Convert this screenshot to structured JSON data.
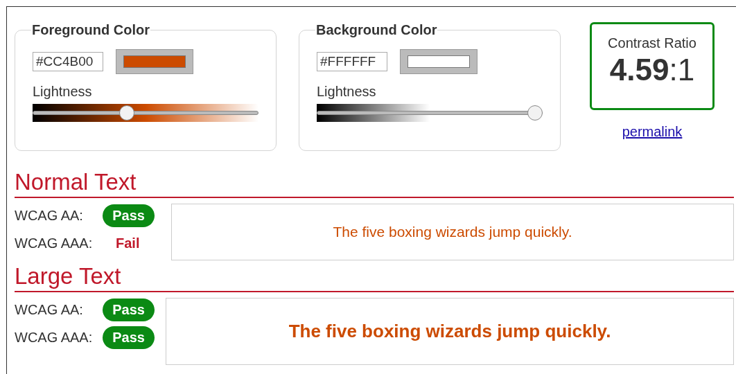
{
  "colors": [
    {
      "legend": "Foreground Color",
      "value": "#CC4B00",
      "color": "#cc4b00",
      "slider_label": "Lightness",
      "level": 0.41
    },
    {
      "legend": "Background Color",
      "value": "#FFFFFF",
      "color": "#ffffff",
      "slider_label": "Lightness",
      "level": 1.0
    }
  ],
  "contrast": {
    "label": "Contrast Ratio",
    "ratio": "4.59",
    "suffix": ":1",
    "passed": true,
    "link": "permalink"
  },
  "sections": [
    {
      "title": "Normal Text",
      "kind": "normal",
      "sample": "The five boxing wizards jump quickly.",
      "rows": [
        {
          "label": "WCAG AA:",
          "passed": true,
          "text": "Pass"
        },
        {
          "label": "WCAG AAA:",
          "passed": false,
          "text": "Fail"
        }
      ]
    },
    {
      "title": "Large Text",
      "kind": "large",
      "sample": "The five boxing wizards jump quickly.",
      "rows": [
        {
          "label": "WCAG AA:",
          "passed": true,
          "text": "Pass"
        },
        {
          "label": "WCAG AAA:",
          "passed": true,
          "text": "Pass"
        }
      ]
    }
  ]
}
